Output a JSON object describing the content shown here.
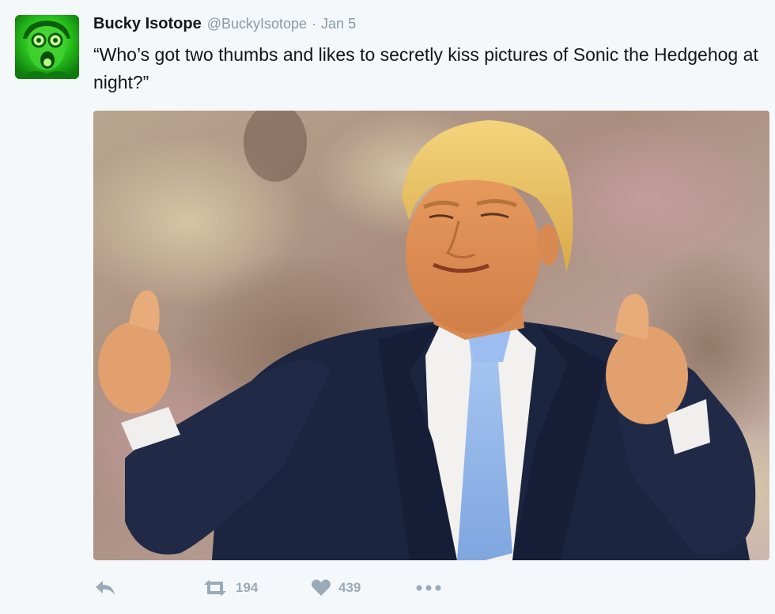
{
  "tweet": {
    "display_name": "Bucky Isotope",
    "handle": "@BuckyIsotope",
    "separator": "·",
    "date": "Jan 5",
    "text": "“Who’s got two thumbs and likes to secretly kiss pictures of Sonic the Hedgehog at night?”"
  },
  "actions": {
    "reply_icon": "reply-icon",
    "retweet_icon": "retweet-icon",
    "retweet_count": "194",
    "like_icon": "heart-icon",
    "like_count": "439",
    "more_icon": "more-dots-icon"
  },
  "colors": {
    "background": "#f5f8fa",
    "text": "#14171a",
    "muted": "#8899a6",
    "action_gray": "#9aaab8",
    "avatar_green": "#1db81d"
  }
}
